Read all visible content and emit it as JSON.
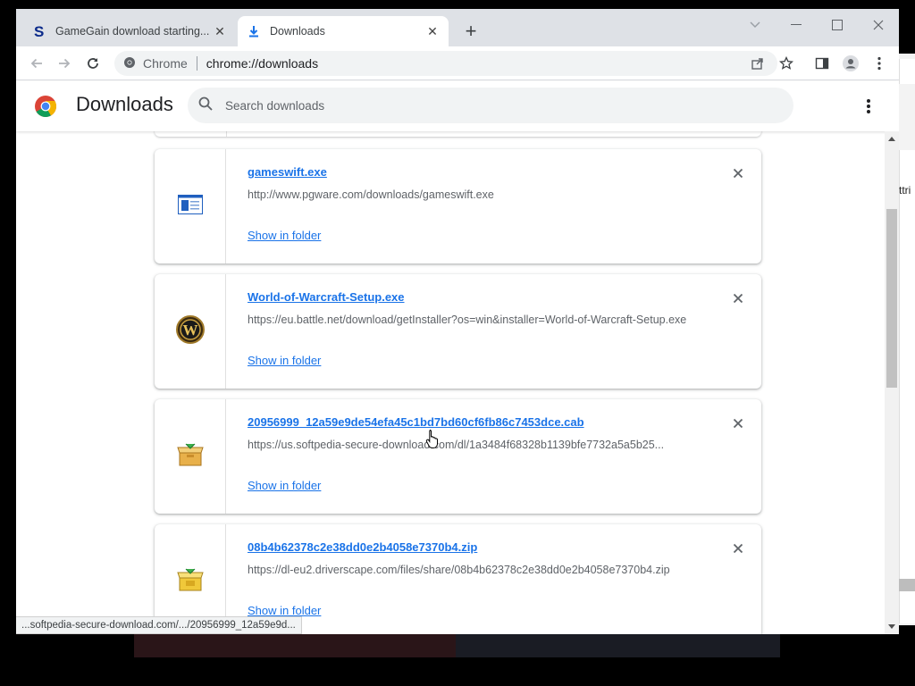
{
  "browser": {
    "tabs": [
      {
        "title": "GameGain download starting...",
        "favicon": "softpedia-s-icon",
        "active": false
      },
      {
        "title": "Downloads",
        "favicon": "download-icon",
        "active": true
      }
    ],
    "new_tab": "+",
    "window_controls": [
      "tab-search",
      "minimize",
      "maximize",
      "close"
    ],
    "site_chip": "Chrome",
    "url": "chrome://downloads",
    "status_url": "...softpedia-secure-download.com/.../20956999_12a59e9d..."
  },
  "downloads_page": {
    "title": "Downloads",
    "search_placeholder": "Search downloads",
    "items": [
      {
        "filename": "gameswift.exe",
        "url": "http://www.pgware.com/downloads/gameswift.exe",
        "action": "Show in folder",
        "icon": "exe-file-icon"
      },
      {
        "filename": "World-of-Warcraft-Setup.exe",
        "url": "https://eu.battle.net/download/getInstaller?os=win&installer=World-of-Warcraft-Setup.exe",
        "action": "Show in folder",
        "icon": "wow-logo-icon"
      },
      {
        "filename": "20956999_12a59e9de54efa45c1bd7bd60cf6fb86c7453dce.cab",
        "url": "https://us.softpedia-secure-download.com/dl/1a3484f68328b1139bfe7732a5a5b25...",
        "action": "Show in folder",
        "icon": "cab-archive-icon"
      },
      {
        "filename": "08b4b62378c2e38dd0e2b4058e7370b4.zip",
        "url": "https://dl-eu2.driverscape.com/files/share/08b4b62378c2e38dd0e2b4058e7370b4.zip",
        "action": "Show in folder",
        "icon": "zip-archive-icon"
      }
    ]
  },
  "background": {
    "side_text": "ttri"
  },
  "colors": {
    "link": "#1a73e8",
    "tabstrip": "#dee1e6",
    "omnibox": "#f1f3f4"
  }
}
